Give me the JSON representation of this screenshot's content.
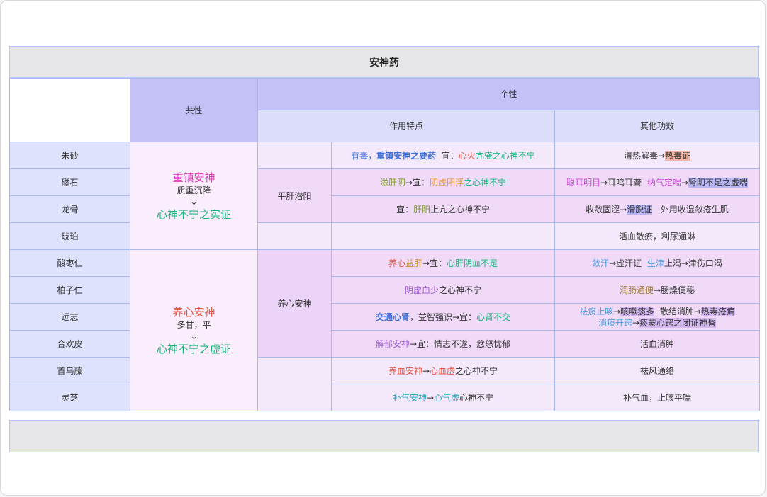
{
  "title": "安神药",
  "header": {
    "common": "共性",
    "individual": "个性",
    "feature": "作用特点",
    "other": "其他功效"
  },
  "group1": {
    "name": "重镇安神",
    "property": "质重沉降",
    "arrow": "↓",
    "target": "心神不宁之实证",
    "sub": "平肝潜阳"
  },
  "group2": {
    "name": "养心安神",
    "property": "多甘，平",
    "arrow": "↓",
    "target": "心神不宁之虚证",
    "sub": "养心安神"
  },
  "rows": [
    {
      "herb": "朱砂",
      "feature": [
        {
          "t": "有毒，",
          "c": "c-blue"
        },
        {
          "t": "重镇安神之要药",
          "c": "c-bblue"
        },
        {
          "t": "  宜：",
          "c": "c-dark"
        },
        {
          "t": "心火",
          "c": "c-red"
        },
        {
          "t": "亢盛之心神不宁",
          "c": "c-teal"
        }
      ],
      "other": [
        {
          "t": "清热解毒→",
          "c": "c-dark"
        },
        {
          "t": "热毒证",
          "c": "c-dark hl-red"
        }
      ]
    },
    {
      "herb": "磁石",
      "feature": [
        {
          "t": "滋肝阴",
          "c": "c-olive"
        },
        {
          "t": "→宜：",
          "c": "c-dark"
        },
        {
          "t": "阴虚阳浮",
          "c": "c-orange"
        },
        {
          "t": "之心神不宁",
          "c": "c-teal"
        }
      ],
      "other": [
        {
          "t": "聪耳明目",
          "c": "c-mag"
        },
        {
          "t": "→耳鸣耳聋  ",
          "c": "c-dark"
        },
        {
          "t": "纳气定喘",
          "c": "c-mag"
        },
        {
          "t": "→",
          "c": "c-dark"
        },
        {
          "t": "肾阴不足之虚喘",
          "c": "c-dark hl-blue"
        }
      ]
    },
    {
      "herb": "龙骨",
      "feature": [
        {
          "t": "宜：",
          "c": "c-dark"
        },
        {
          "t": "肝阳",
          "c": "c-olive"
        },
        {
          "t": "上亢之心神不宁",
          "c": "c-dark"
        }
      ],
      "other": [
        {
          "t": "收敛固涩→",
          "c": "c-dark"
        },
        {
          "t": "滑脱证",
          "c": "c-dark hl-blue"
        },
        {
          "t": "   外用收湿敛疮生肌",
          "c": "c-dark"
        }
      ]
    },
    {
      "herb": "琥珀",
      "feature": [],
      "other": [
        {
          "t": "活血散瘀，利尿通淋",
          "c": "c-dark"
        }
      ]
    },
    {
      "herb": "酸枣仁",
      "feature": [
        {
          "t": "养心",
          "c": "c-red"
        },
        {
          "t": "益肝",
          "c": "c-gold"
        },
        {
          "t": "→宜：",
          "c": "c-dark"
        },
        {
          "t": "心肝阴血不足",
          "c": "c-teal"
        }
      ],
      "other": [
        {
          "t": "敛汗",
          "c": "c-sky"
        },
        {
          "t": "→虚汗证  ",
          "c": "c-dark"
        },
        {
          "t": "生津",
          "c": "c-sky"
        },
        {
          "t": "止渴→津伤口渴",
          "c": "c-dark"
        }
      ]
    },
    {
      "herb": "柏子仁",
      "feature": [
        {
          "t": "阴虚血少",
          "c": "c-purple"
        },
        {
          "t": "之心神不宁",
          "c": "c-dark"
        }
      ],
      "other": [
        {
          "t": "润肠通便",
          "c": "c-tan"
        },
        {
          "t": "→肠燥便秘",
          "c": "c-dark"
        }
      ]
    },
    {
      "herb": "远志",
      "feature": [
        {
          "t": "交通心肾",
          "c": "c-bblue"
        },
        {
          "t": "，益智强识→宜：",
          "c": "c-dark"
        },
        {
          "t": "心肾不交",
          "c": "c-teal"
        }
      ],
      "other_lines": [
        [
          {
            "t": "祛痰止咳",
            "c": "c-sky"
          },
          {
            "t": "→",
            "c": "c-dark"
          },
          {
            "t": "咳嗽痰多",
            "c": "c-dark hl-lav"
          },
          {
            "t": "  散结消肿→",
            "c": "c-dark"
          },
          {
            "t": "热毒疮痈",
            "c": "c-dark hl-lav"
          }
        ],
        [
          {
            "t": "消痰开窍",
            "c": "c-sky"
          },
          {
            "t": "→",
            "c": "c-dark"
          },
          {
            "t": "痰蒙心窍之闭证神昏",
            "c": "c-dark hl-lav"
          }
        ]
      ]
    },
    {
      "herb": "合欢皮",
      "feature": [
        {
          "t": "解郁安神",
          "c": "c-purple"
        },
        {
          "t": "→宜：情志不遂，忿怒忧郁",
          "c": "c-dark"
        }
      ],
      "other": [
        {
          "t": "活血消肿",
          "c": "c-dark"
        }
      ]
    },
    {
      "herb": "首乌藤",
      "feature": [
        {
          "t": "养血安神",
          "c": "c-red"
        },
        {
          "t": "→",
          "c": "c-dark"
        },
        {
          "t": "心血虚",
          "c": "c-red"
        },
        {
          "t": "之心神不宁",
          "c": "c-dark"
        }
      ],
      "other": [
        {
          "t": "祛风通络",
          "c": "c-dark"
        }
      ]
    },
    {
      "herb": "灵芝",
      "feature": [
        {
          "t": "补气安神",
          "c": "c-cyan"
        },
        {
          "t": "→",
          "c": "c-dark"
        },
        {
          "t": "心气虚",
          "c": "c-cyan"
        },
        {
          "t": "心神不宁",
          "c": "c-dark"
        }
      ],
      "other": [
        {
          "t": "补气血，止咳平喘",
          "c": "c-dark"
        }
      ]
    }
  ]
}
